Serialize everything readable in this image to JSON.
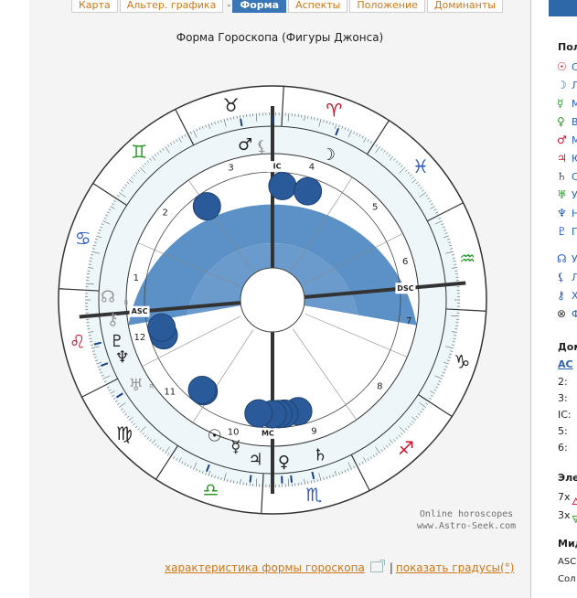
{
  "tabs": [
    {
      "label": "Карта",
      "active": false
    },
    {
      "label": "Альтер. графика",
      "active": false
    },
    {
      "label": "-",
      "active": false,
      "separator": true
    },
    {
      "label": "Форма",
      "active": true
    },
    {
      "label": "Аспекты",
      "active": false
    },
    {
      "label": "Положение",
      "active": false
    },
    {
      "label": "Доминанты",
      "active": false
    }
  ],
  "chart_title": "Форма Гороскопа (Фигуры Джонса)",
  "signs": [
    {
      "glyph": "♈",
      "color": "#d0102a"
    },
    {
      "glyph": "♉",
      "color": "#222222"
    },
    {
      "glyph": "♊",
      "color": "#2a9a2a"
    },
    {
      "glyph": "♋",
      "color": "#2a5ac8"
    },
    {
      "glyph": "♌",
      "color": "#d0102a"
    },
    {
      "glyph": "♍",
      "color": "#222222"
    },
    {
      "glyph": "♎",
      "color": "#2a9a2a"
    },
    {
      "glyph": "♏",
      "color": "#2a5ac8"
    },
    {
      "glyph": "♐",
      "color": "#d0102a"
    },
    {
      "glyph": "♑",
      "color": "#222222"
    },
    {
      "glyph": "♒",
      "color": "#2a9a2a"
    },
    {
      "glyph": "♓",
      "color": "#2a5ac8"
    }
  ],
  "house_numbers": [
    "1",
    "2",
    "3",
    "4",
    "5",
    "6",
    "7",
    "8",
    "9",
    "10",
    "11",
    "12"
  ],
  "axes": {
    "asc": "ASC",
    "dsc": "DSC",
    "mc": "MC",
    "ic": "IC"
  },
  "planets": [
    {
      "glyph": "♄",
      "color": "#222222"
    },
    {
      "glyph": "♀",
      "color": "#222222"
    },
    {
      "glyph": "♃",
      "color": "#222222"
    },
    {
      "glyph": "☿",
      "color": "#222222"
    },
    {
      "glyph": "☉",
      "color": "#222222"
    },
    {
      "glyph": "♅",
      "color": "#999999"
    },
    {
      "glyph": "♆",
      "color": "#222222"
    },
    {
      "glyph": "♇",
      "color": "#222222"
    },
    {
      "glyph": "⚷",
      "color": "#999999"
    },
    {
      "glyph": "♂",
      "color": "#222222"
    },
    {
      "glyph": "⚸",
      "color": "#999999"
    },
    {
      "glyph": "☽",
      "color": "#222222"
    },
    {
      "glyph": "☊",
      "color": "#999999"
    },
    {
      "glyph": "⚴",
      "color": "#222222"
    }
  ],
  "retrograde_mark": "R",
  "watermark": {
    "line1": "Online horoscopes",
    "line2": "www.Astro-Seek.com"
  },
  "links": {
    "shape_info": "характеристика формы гороскопа",
    "separator": "|",
    "show_degrees": "показать градусы(°)"
  },
  "right_panel": {
    "heading1": "Пол",
    "items": [
      {
        "glyph": "☉",
        "color": "#d0102a",
        "text": "С"
      },
      {
        "glyph": "☽",
        "color": "#2a5ac8",
        "text": "Л"
      },
      {
        "glyph": "☿",
        "color": "#2a9a2a",
        "text": "М"
      },
      {
        "glyph": "♀",
        "color": "#2a9a2a",
        "text": "В"
      },
      {
        "glyph": "♂",
        "color": "#d0102a",
        "text": "М"
      },
      {
        "glyph": "♃",
        "color": "#d0102a",
        "text": "Ю"
      },
      {
        "glyph": "♄",
        "color": "#555555",
        "text": "С"
      },
      {
        "glyph": "♅",
        "color": "#2a9a2a",
        "text": "У"
      },
      {
        "glyph": "♆",
        "color": "#2a5ac8",
        "text": "Н"
      },
      {
        "glyph": "♇",
        "color": "#2a5ac8",
        "text": "П"
      },
      {
        "glyph": "☊",
        "color": "#2a5ac8",
        "text": "У"
      },
      {
        "glyph": "⚸",
        "color": "#2a5ac8",
        "text": "Л"
      },
      {
        "glyph": "⚷",
        "color": "#2a5ac8",
        "text": "Х"
      },
      {
        "glyph": "⊗",
        "color": "#333333",
        "text": "Ф"
      }
    ],
    "heading2": "Дом",
    "asc_label": "AC",
    "house_rows": [
      "2:",
      "3:",
      "IC:",
      "5:",
      "6:"
    ],
    "heading3": "Эле",
    "elem_rows": [
      {
        "count": "7x",
        "glyph": "🜂",
        "color": "#d0102a"
      },
      {
        "count": "3x",
        "glyph": "🜃",
        "color": "#2a9a2a"
      }
    ],
    "heading4": "Мид",
    "mid_rows": [
      "ASC",
      "Сол"
    ]
  }
}
